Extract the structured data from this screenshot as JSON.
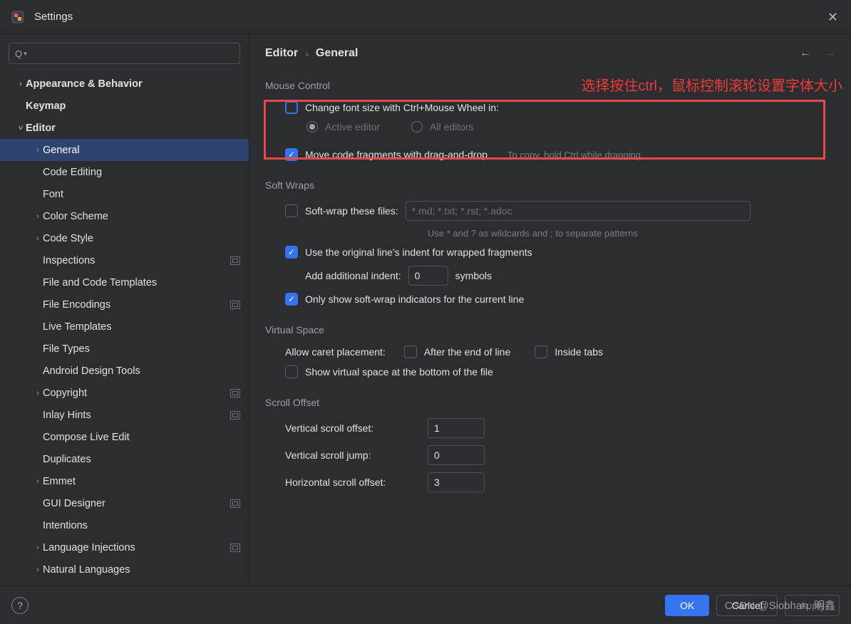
{
  "window": {
    "title": "Settings"
  },
  "breadcrumb": {
    "part1": "Editor",
    "part2": "General"
  },
  "annotation": "选择按住ctrl，鼠标控制滚轮设置字体大小",
  "sidebar": {
    "items": [
      {
        "label": "Appearance & Behavior",
        "level": 0,
        "chev": "right",
        "bold": true,
        "badge": false
      },
      {
        "label": "Keymap",
        "level": 0,
        "chev": "none",
        "bold": true,
        "badge": false
      },
      {
        "label": "Editor",
        "level": 0,
        "chev": "down",
        "bold": true,
        "badge": false
      },
      {
        "label": "General",
        "level": 1,
        "chev": "right",
        "bold": false,
        "badge": false,
        "selected": true
      },
      {
        "label": "Code Editing",
        "level": 1,
        "chev": "none",
        "bold": false,
        "badge": false
      },
      {
        "label": "Font",
        "level": 1,
        "chev": "none",
        "bold": false,
        "badge": false
      },
      {
        "label": "Color Scheme",
        "level": 1,
        "chev": "right",
        "bold": false,
        "badge": false
      },
      {
        "label": "Code Style",
        "level": 1,
        "chev": "right",
        "bold": false,
        "badge": false
      },
      {
        "label": "Inspections",
        "level": 1,
        "chev": "none",
        "bold": false,
        "badge": true
      },
      {
        "label": "File and Code Templates",
        "level": 1,
        "chev": "none",
        "bold": false,
        "badge": false
      },
      {
        "label": "File Encodings",
        "level": 1,
        "chev": "none",
        "bold": false,
        "badge": true
      },
      {
        "label": "Live Templates",
        "level": 1,
        "chev": "none",
        "bold": false,
        "badge": false
      },
      {
        "label": "File Types",
        "level": 1,
        "chev": "none",
        "bold": false,
        "badge": false
      },
      {
        "label": "Android Design Tools",
        "level": 1,
        "chev": "none",
        "bold": false,
        "badge": false
      },
      {
        "label": "Copyright",
        "level": 1,
        "chev": "right",
        "bold": false,
        "badge": true
      },
      {
        "label": "Inlay Hints",
        "level": 1,
        "chev": "none",
        "bold": false,
        "badge": true
      },
      {
        "label": "Compose Live Edit",
        "level": 1,
        "chev": "none",
        "bold": false,
        "badge": false
      },
      {
        "label": "Duplicates",
        "level": 1,
        "chev": "none",
        "bold": false,
        "badge": false
      },
      {
        "label": "Emmet",
        "level": 1,
        "chev": "right",
        "bold": false,
        "badge": false
      },
      {
        "label": "GUI Designer",
        "level": 1,
        "chev": "none",
        "bold": false,
        "badge": true
      },
      {
        "label": "Intentions",
        "level": 1,
        "chev": "none",
        "bold": false,
        "badge": false
      },
      {
        "label": "Language Injections",
        "level": 1,
        "chev": "right",
        "bold": false,
        "badge": true
      },
      {
        "label": "Natural Languages",
        "level": 1,
        "chev": "right",
        "bold": false,
        "badge": false
      }
    ]
  },
  "sections": {
    "mouse": {
      "title": "Mouse Control",
      "changeFontSize": "Change font size with Ctrl+Mouse Wheel in:",
      "activeEditor": "Active editor",
      "allEditors": "All editors",
      "moveFragments": "Move code fragments with drag-and-drop",
      "moveFragmentsHint": "To copy, hold Ctrl while dragging"
    },
    "softwraps": {
      "title": "Soft Wraps",
      "softWrapThese": "Soft-wrap these files:",
      "placeholder": "*.md; *.txt; *.rst; *.adoc",
      "wildcardHint": "Use * and ? as wildcards and ; to separate patterns",
      "useOriginal": "Use the original line's indent for wrapped fragments",
      "addIndent": "Add additional indent:",
      "indentValue": "0",
      "symbols": "symbols",
      "onlyShow": "Only show soft-wrap indicators for the current line"
    },
    "virtual": {
      "title": "Virtual Space",
      "allowCaret": "Allow caret placement:",
      "afterEol": "After the end of line",
      "insideTabs": "Inside tabs",
      "showVirtual": "Show virtual space at the bottom of the file"
    },
    "scroll": {
      "title": "Scroll Offset",
      "vso": "Vertical scroll offset:",
      "vsoValue": "1",
      "vsj": "Vertical scroll jump:",
      "vsjValue": "0",
      "hso": "Horizontal scroll offset:",
      "hsoValue": "3"
    }
  },
  "footer": {
    "ok": "OK",
    "cancel": "Cancel",
    "apply": "Apply"
  },
  "watermark": "CSDN @Siobhan. 明鑫"
}
